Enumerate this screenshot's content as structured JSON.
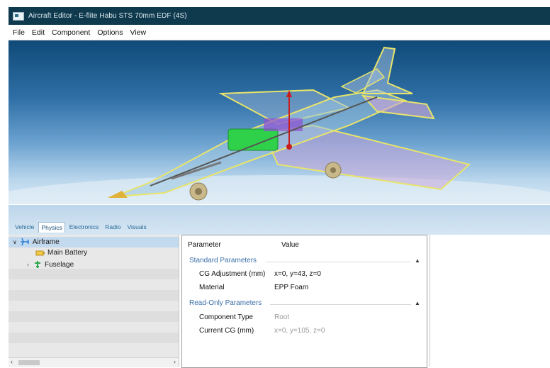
{
  "window": {
    "title": "Aircraft Editor - E-flite Habu STS 70mm EDF (4S)"
  },
  "menu": [
    "File",
    "Edit",
    "Component",
    "Options",
    "View"
  ],
  "tabs": [
    {
      "label": "Vehicle",
      "active": false
    },
    {
      "label": "Physics",
      "active": true
    },
    {
      "label": "Electronics",
      "active": false
    },
    {
      "label": "Radio",
      "active": false
    },
    {
      "label": "Visuals",
      "active": false
    }
  ],
  "tree": [
    {
      "label": "Airframe",
      "icon": "airplane-icon",
      "expanded": true,
      "selected": true
    },
    {
      "label": "Main Battery",
      "icon": "battery-icon"
    },
    {
      "label": "Fuselage",
      "icon": "fuselage-icon",
      "expandable": true
    }
  ],
  "params": {
    "header_parameter": "Parameter",
    "header_value": "Value",
    "sections": [
      {
        "title": "Standard Parameters",
        "rows": [
          {
            "name": "CG Adjustment (mm)",
            "value": "x=0, y=43, z=0",
            "readonly": false
          },
          {
            "name": "Material",
            "value": "EPP Foam",
            "readonly": false
          }
        ]
      },
      {
        "title": "Read-Only Parameters",
        "rows": [
          {
            "name": "Component Type",
            "value": "Root",
            "readonly": true
          },
          {
            "name": "Current CG (mm)",
            "value": "x=0, y=105, z=0",
            "readonly": true
          }
        ]
      }
    ]
  },
  "colors": {
    "titlebar": "#0f3a4e",
    "link_blue": "#3b6fa8",
    "selection": "#c3d9ee",
    "wireframe": "#e8e46a"
  }
}
